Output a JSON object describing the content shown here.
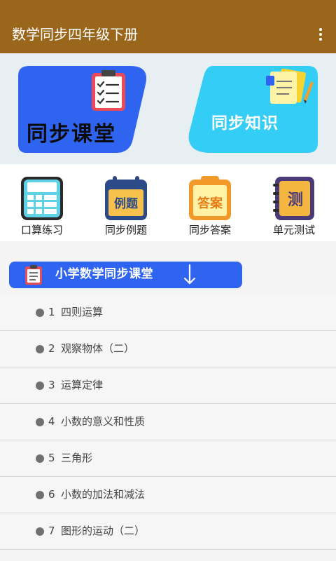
{
  "app": {
    "title": "数学同步四年级下册",
    "menu_icon": "more-vert-icon"
  },
  "banner": {
    "left_card": {
      "title": "同步课堂",
      "color": "#2e64f0",
      "icon": "clipboard-checklist-icon"
    },
    "right_card": {
      "title": "同步知识",
      "color": "#33cdf5",
      "icon": "notes-pencil-icon"
    }
  },
  "shortcuts": [
    {
      "label": "口算练习",
      "icon": "calculator-icon"
    },
    {
      "label": "同步例题",
      "icon": "calendar-example-icon",
      "badge": "例题"
    },
    {
      "label": "同步答案",
      "icon": "clipboard-answer-icon",
      "badge": "答案"
    },
    {
      "label": "单元测试",
      "icon": "notebook-test-icon",
      "badge": "测"
    }
  ],
  "section": {
    "title": "小学数学同步课堂",
    "icon": "clipboard-icon",
    "arrow_icon": "arrow-down-icon",
    "color": "#2e64f0"
  },
  "units": [
    {
      "num": "1",
      "title": "四则运算"
    },
    {
      "num": "2",
      "title": "观察物体（二）"
    },
    {
      "num": "3",
      "title": "运算定律"
    },
    {
      "num": "4",
      "title": "小数的意义和性质"
    },
    {
      "num": "5",
      "title": "三角形"
    },
    {
      "num": "6",
      "title": "小数的加法和减法"
    },
    {
      "num": "7",
      "title": "图形的运动（二）"
    }
  ]
}
